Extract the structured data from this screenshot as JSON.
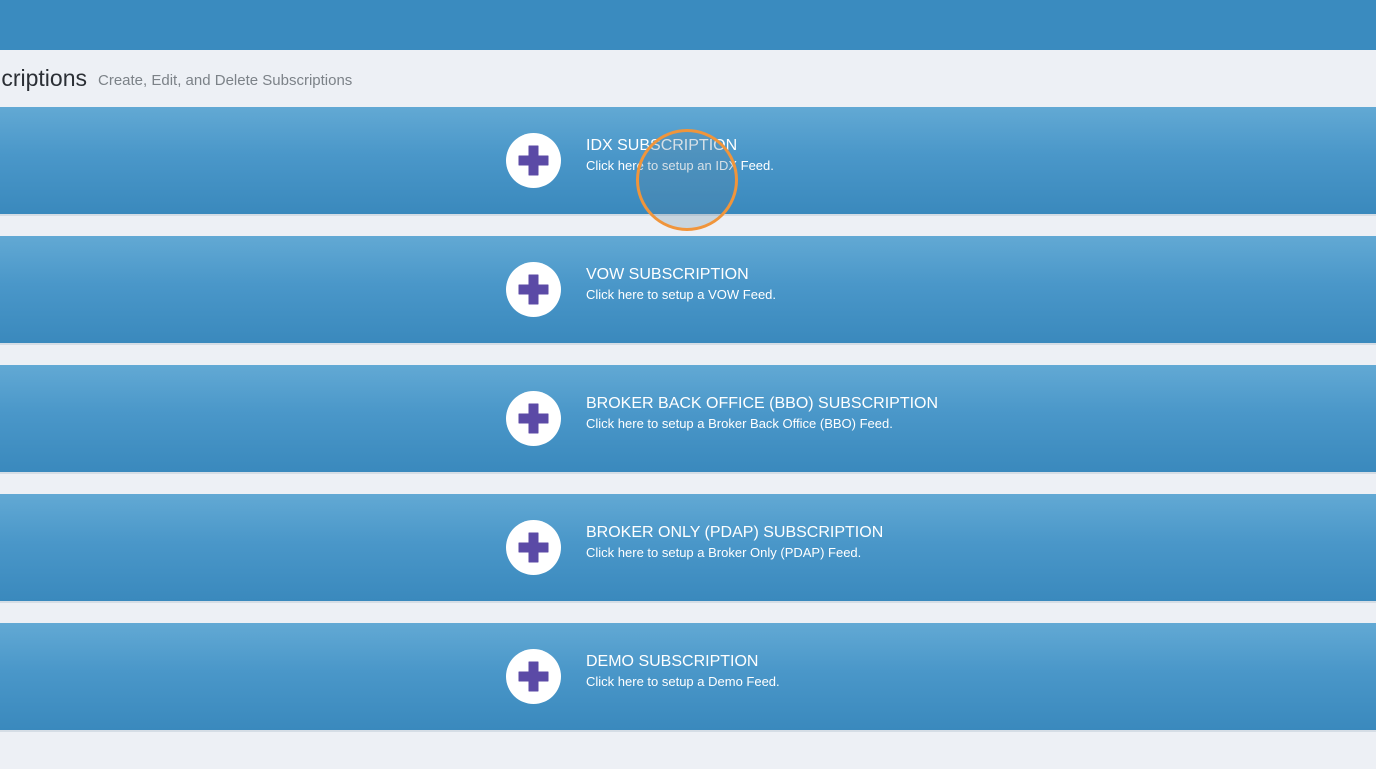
{
  "header": {
    "title": "criptions",
    "subtitle": "Create, Edit, and Delete Subscriptions"
  },
  "icons": {
    "add": "plus-icon"
  },
  "colors": {
    "top_bar": "#3a8bbf",
    "row_gradient_top": "#62a9d4",
    "row_gradient_bottom": "#3a89bd",
    "plus_icon": "#5b4aa6",
    "background": "#edf0f5",
    "click_indicator": "#f0953b"
  },
  "subscriptions": [
    {
      "title": "IDX SUBSCRIPTION",
      "description": "Click here to setup an IDX Feed."
    },
    {
      "title": "VOW SUBSCRIPTION",
      "description": "Click here to setup a VOW Feed."
    },
    {
      "title": "BROKER BACK OFFICE (BBO) SUBSCRIPTION",
      "description": "Click here to setup a Broker Back Office (BBO) Feed."
    },
    {
      "title": "BROKER ONLY (PDAP) SUBSCRIPTION",
      "description": "Click here to setup a Broker Only (PDAP) Feed."
    },
    {
      "title": "DEMO SUBSCRIPTION",
      "description": "Click here to setup a Demo Feed."
    }
  ]
}
